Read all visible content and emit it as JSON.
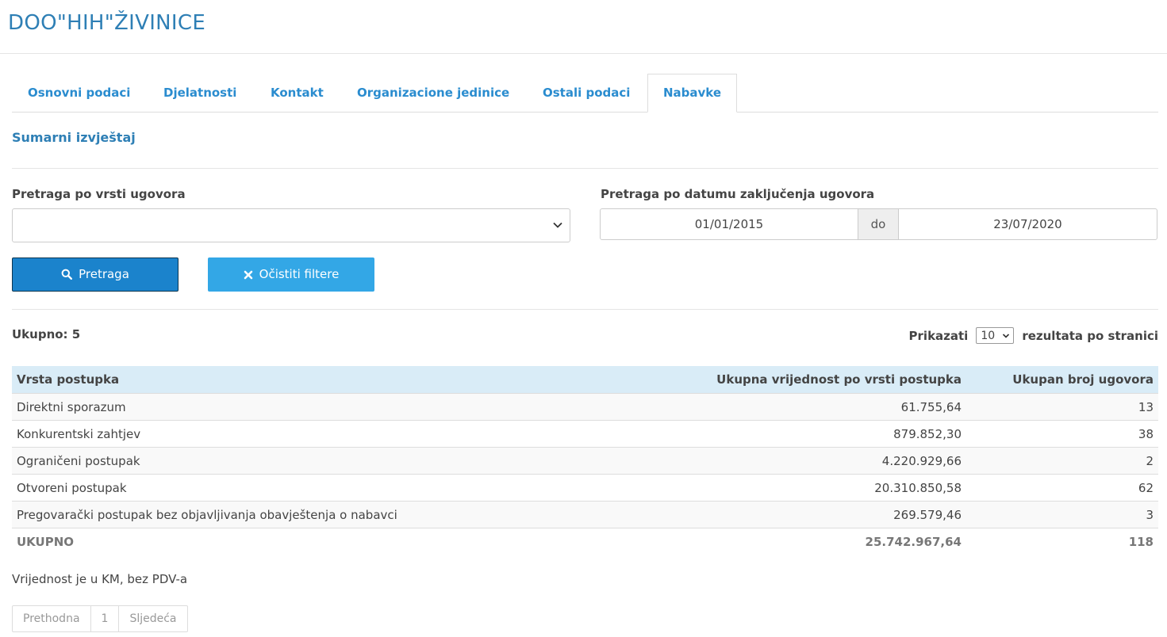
{
  "header": {
    "title": "DOO\"HIH\"ŽIVINICE"
  },
  "tabs": [
    {
      "label": "Osnovni podaci"
    },
    {
      "label": "Djelatnosti"
    },
    {
      "label": "Kontakt"
    },
    {
      "label": "Organizacione jedinice"
    },
    {
      "label": "Ostali podaci"
    },
    {
      "label": "Nabavke"
    }
  ],
  "section": {
    "title": "Sumarni izvještaj"
  },
  "filters": {
    "contract_type_label": "Pretraga po vrsti ugovora",
    "contract_type_value": "",
    "date_label": "Pretraga po datumu zaključenja ugovora",
    "date_from": "01/01/2015",
    "date_separator": "do",
    "date_to": "23/07/2020",
    "search_button": "Pretraga",
    "clear_button": "Očistiti filtere"
  },
  "results": {
    "total_label": "Ukupno: 5",
    "show_label": "Prikazati",
    "per_page_value": "10",
    "per_page_suffix": "rezultata po stranici"
  },
  "table": {
    "headers": [
      "Vrsta postupka",
      "Ukupna vrijednost po vrsti postupka",
      "Ukupan broj ugovora"
    ],
    "rows": [
      {
        "type": "Direktni sporazum",
        "value": "61.755,64",
        "count": "13"
      },
      {
        "type": "Konkurentski zahtjev",
        "value": "879.852,30",
        "count": "38"
      },
      {
        "type": "Ograničeni postupak",
        "value": "4.220.929,66",
        "count": "2"
      },
      {
        "type": "Otvoreni postupak",
        "value": "20.310.850,58",
        "count": "62"
      },
      {
        "type": "Pregovarački postupak bez objavljivanja obavještenja o nabavci",
        "value": "269.579,46",
        "count": "3"
      }
    ],
    "total": {
      "label": "UKUPNO",
      "value": "25.742.967,64",
      "count": "118"
    }
  },
  "note": "Vrijednost je u KM, bez PDV-a",
  "pagination": {
    "prev": "Prethodna",
    "page": "1",
    "next": "Sljedeća"
  },
  "colors": {
    "accent": "#2a8ccf",
    "primary_button": "#1b83cc",
    "clear_button": "#33a7e6",
    "table_header": "#d9ecf7"
  },
  "icons": {
    "search": "search-icon",
    "clear": "close-icon",
    "dropdown": "chevron-down-icon"
  }
}
